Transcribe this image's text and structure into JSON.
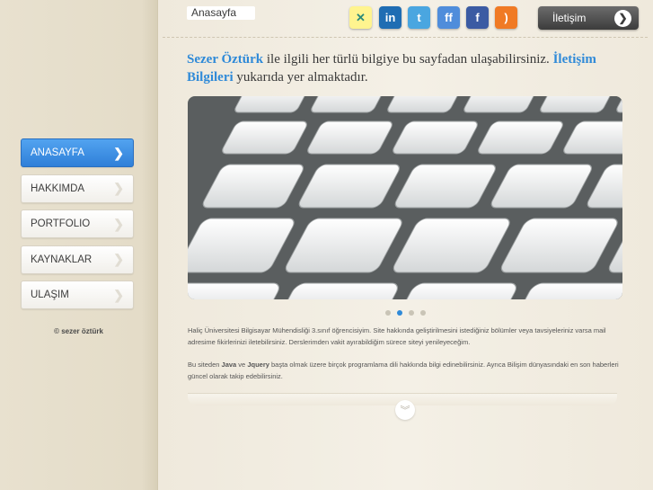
{
  "header": {
    "home_tab": "Anasayfa",
    "contact_button": "İletişim"
  },
  "social": [
    {
      "name": "xing-icon",
      "glyph": "✕",
      "color": "#fff48f"
    },
    {
      "name": "linkedin-icon",
      "glyph": "in",
      "color": "#1f6db3"
    },
    {
      "name": "twitter-icon",
      "glyph": "t",
      "color": "#4aa6e0"
    },
    {
      "name": "friendfeed-icon",
      "glyph": "ff",
      "color": "#4f8ddb"
    },
    {
      "name": "facebook-icon",
      "glyph": "f",
      "color": "#3b5ba3"
    },
    {
      "name": "rss-icon",
      "glyph": ")",
      "color": "#f07a24"
    }
  ],
  "nav": {
    "items": [
      {
        "label": "ANASAYFA",
        "active": true
      },
      {
        "label": "HAKKIMDA",
        "active": false
      },
      {
        "label": "PORTFOLIO",
        "active": false
      },
      {
        "label": "KAYNAKLAR",
        "active": false
      },
      {
        "label": "ULAŞIM",
        "active": false
      }
    ]
  },
  "footer": {
    "copyright": "© sezer öztürk"
  },
  "intro": {
    "name": "Sezer Öztürk",
    "text1": " ile ilgili her türlü bilgiye bu sayfadan ulaşabilirsiniz. ",
    "link": "İletişim Bilgileri",
    "text2": " yukarıda yer almaktadır."
  },
  "slider": {
    "dots": 4,
    "active_dot": 1
  },
  "body": {
    "p1": "Haliç Üniversitesi Bilgisayar Mühendisliği 3.sınıf öğrencisiyim. Site hakkında geliştirilmesini istediğiniz bölümler veya tavsiyeleriniz varsa mail adresime fikirlerinizi iletebilirsiniz. Derslerimden vakit ayırabildiğim sürece siteyi yenileyeceğim.",
    "p2_pre": "Bu siteden ",
    "java": "Java",
    "p2_mid": " ve ",
    "jquery": "Jquery",
    "p2_post": " başta olmak üzere birçok programlama dili hakkında bilgi edinebilirsiniz. Ayrıca Bilişim dünyasındaki en son haberleri güncel olarak takip edebilirsiniz."
  }
}
